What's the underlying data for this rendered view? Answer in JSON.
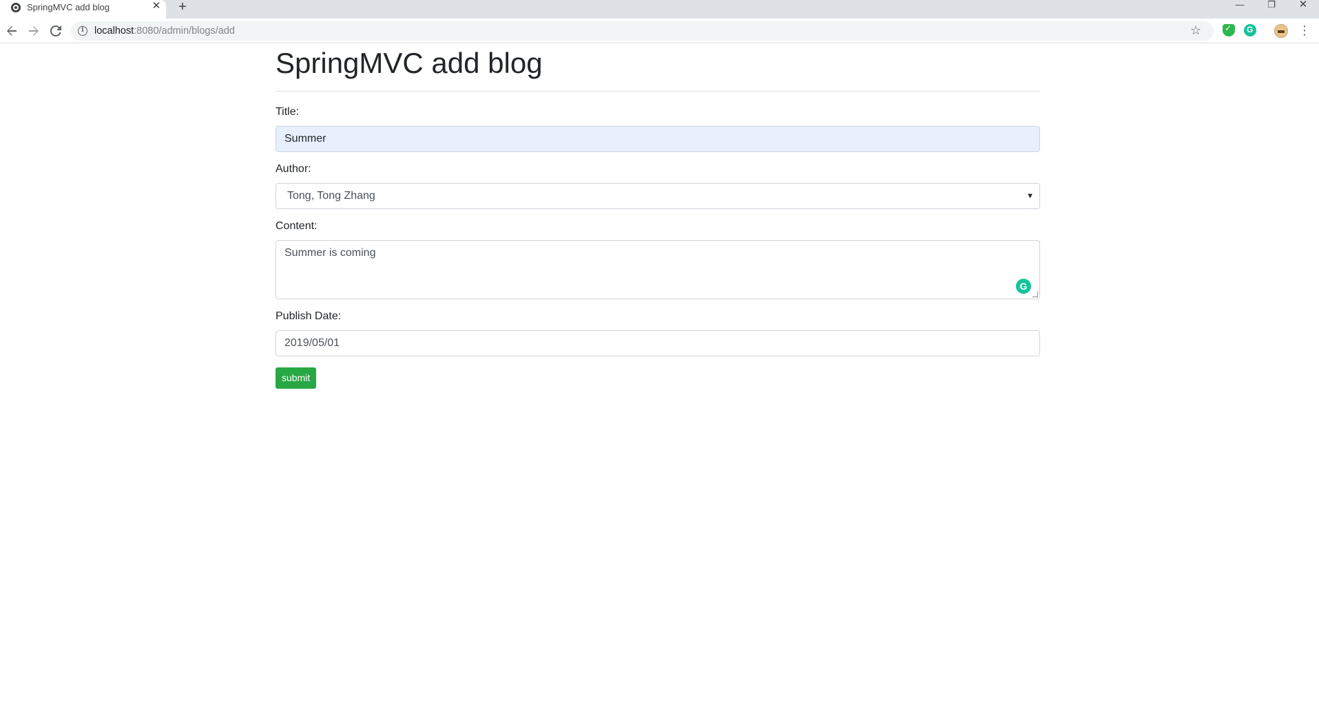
{
  "browser": {
    "tab_title": "SpringMVC add blog",
    "tab_close": "✕",
    "new_tab": "+",
    "url_host": "localhost",
    "url_path": ":8080/admin/blogs/add",
    "window_min": "—",
    "window_max": "❐",
    "window_close": "✕",
    "star": "☆",
    "menu": "⋮"
  },
  "page": {
    "heading": "SpringMVC add blog"
  },
  "form": {
    "title_label": "Title:",
    "title_value": "Summer",
    "author_label": "Author:",
    "author_value": "Tong, Tong Zhang",
    "content_label": "Content:",
    "content_value": "Summer is coming",
    "date_label": "Publish Date:",
    "date_value": "2019/05/01",
    "submit_label": "submit"
  },
  "colors": {
    "submit": "#28a745",
    "title_autofill": "#e8f0fe",
    "grammarly": "#15c39a"
  }
}
